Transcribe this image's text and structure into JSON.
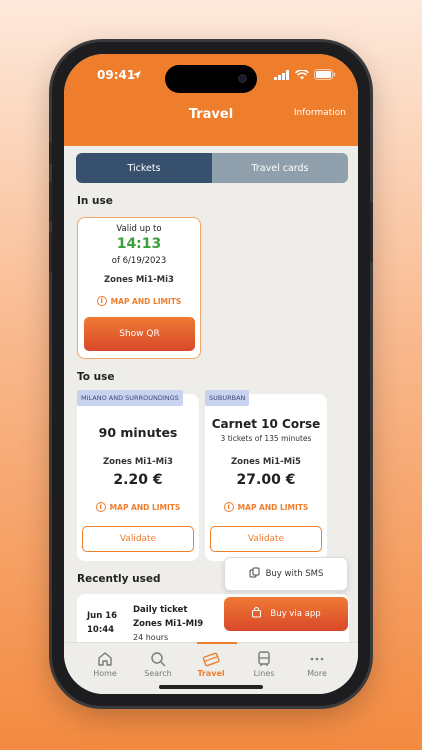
{
  "status": {
    "time": "09:41"
  },
  "header": {
    "title": "Travel",
    "info_link": "Information"
  },
  "tabs": {
    "tickets": "Tickets",
    "travel_cards": "Travel cards"
  },
  "in_use": {
    "heading": "In use",
    "valid_up_to": "Valid up to",
    "time": "14:13",
    "date": "of 6/19/2023",
    "zones": "Zones Mi1-Mi3",
    "map_link": "MAP AND LIMITS",
    "show_qr": "Show QR"
  },
  "to_use": {
    "heading": "To use",
    "tickets": [
      {
        "badge": "MILANO AND SURROUNDINGS",
        "title": "90 minutes",
        "subtitle": "",
        "zones": "Zones Mi1-Mi3",
        "price": "2.20 €",
        "map_link": "MAP AND LIMITS",
        "validate": "Validate"
      },
      {
        "badge": "SUBURBAN",
        "title": "Carnet 10 Corse",
        "subtitle": "3 tickets of 135 minutes",
        "zones": "Zones Mi1-Mi5",
        "price": "27.00 €",
        "map_link": "MAP AND LIMITS",
        "validate": "Validate"
      }
    ]
  },
  "recently_used": {
    "heading": "Recently used",
    "item": {
      "date": "Jun 16",
      "time": "10:44",
      "name": "Daily ticket",
      "zones": "Zones Mi1-MI9",
      "duration": "24 hours"
    }
  },
  "actions": {
    "buy_sms": "Buy with SMS",
    "buy_app": "Buy via app"
  },
  "tabbar": [
    {
      "label": "Home",
      "icon": "home-icon"
    },
    {
      "label": "Search",
      "icon": "search-icon"
    },
    {
      "label": "Travel",
      "icon": "ticket-icon"
    },
    {
      "label": "Lines",
      "icon": "bus-icon"
    },
    {
      "label": "More",
      "icon": "more-icon"
    }
  ],
  "colors": {
    "accent": "#ee7d2c",
    "tab_active": "#37506e",
    "time_green": "#3aa03a",
    "badge_bg": "#c9d2ef"
  }
}
